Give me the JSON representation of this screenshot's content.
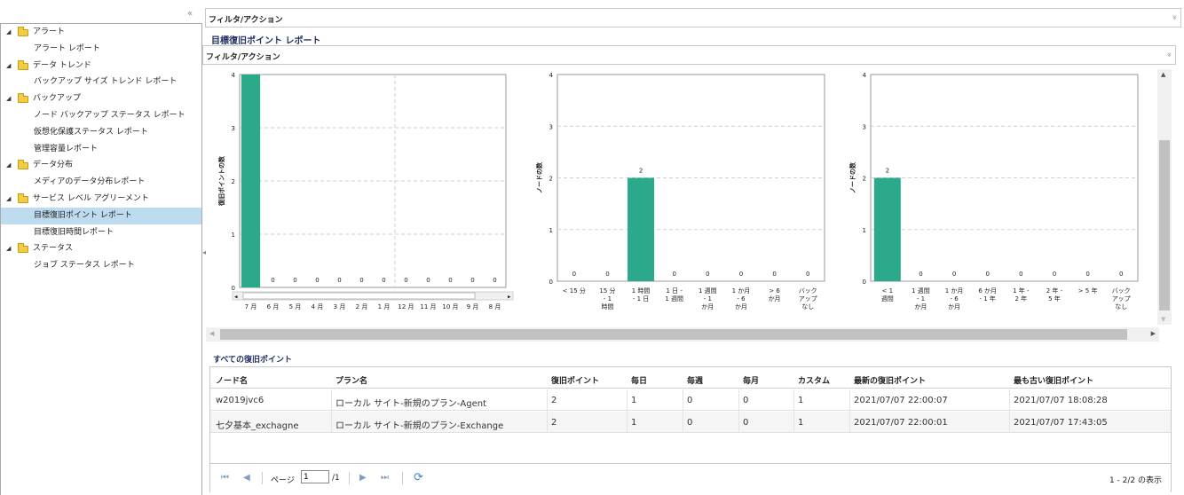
{
  "sidebar": {
    "collapse_glyph": "«",
    "groups": [
      {
        "label": "アラート",
        "items": [
          "アラート レポート"
        ]
      },
      {
        "label": "データ トレンド",
        "items": [
          "バックアップ サイズ トレンド レポート"
        ]
      },
      {
        "label": "バックアップ",
        "items": [
          "ノード バックアップ ステータス レポート",
          "仮想化保護ステータス レポート",
          "管理容量レポート"
        ]
      },
      {
        "label": "データ分布",
        "items": [
          "メディアのデータ分布レポート"
        ]
      },
      {
        "label": "サービス レベル アグリーメント",
        "items": [
          "目標復旧ポイント レポート",
          "目標復旧時間レポート"
        ]
      },
      {
        "label": "ステータス",
        "items": [
          "ジョブ ステータス レポート"
        ]
      }
    ],
    "selected": "目標復旧ポイント レポート"
  },
  "main": {
    "outer_panel_title": "フィルタ/アクション",
    "report_title": "目標復旧ポイント レポート",
    "inner_panel_title": "フィルタ/アクション",
    "grid_title": "すべての復旧ポイント"
  },
  "chart_data": [
    {
      "type": "bar",
      "ylabel": "復旧ポイントの数",
      "ylim": [
        0,
        4
      ],
      "yticks": [
        0,
        1,
        2,
        3,
        4
      ],
      "categories": [
        "7 月",
        "6 月",
        "5 月",
        "4 月",
        "3 月",
        "2 月",
        "1 月",
        "12 月",
        "11 月",
        "10 月",
        "9 月",
        "8 月"
      ],
      "values": [
        4,
        0,
        0,
        0,
        0,
        0,
        0,
        0,
        0,
        0,
        0,
        0
      ],
      "bar_color": "#2aaa8a",
      "grid": true,
      "has_scrollbar": true
    },
    {
      "type": "bar",
      "ylabel": "ノードの数",
      "ylim": [
        0,
        4
      ],
      "yticks": [
        0,
        1,
        2,
        3,
        4
      ],
      "categories": [
        "< 15 分",
        "15 分 - 1 時間",
        "1 時間 - 1 日",
        "1 日 - 1 週間",
        "1 週間 - 1 か月",
        "1 か月 - 6 か月",
        "> 6 か月",
        "バック アップ なし"
      ],
      "category_lines": [
        [
          "< 15 分"
        ],
        [
          "15 分",
          "- 1",
          "時間"
        ],
        [
          "1 時間",
          "- 1 日"
        ],
        [
          "1 日 -",
          "1 週間"
        ],
        [
          "1 週間",
          "- 1",
          "か月"
        ],
        [
          "1 か月",
          "- 6",
          "か月"
        ],
        [
          "> 6",
          "か月"
        ],
        [
          "バック",
          "アップ",
          "なし"
        ]
      ],
      "values": [
        0,
        0,
        2,
        0,
        0,
        0,
        0,
        0
      ],
      "bar_color": "#2aaa8a",
      "grid": true
    },
    {
      "type": "bar",
      "ylabel": "ノードの数",
      "ylim": [
        0,
        4
      ],
      "yticks": [
        0,
        1,
        2,
        3,
        4
      ],
      "categories": [
        "< 1 週間",
        "1 週間 - 1 か月",
        "1 か月 - 6 か月",
        "6 か月 - 1 年",
        "1 年 - 2 年",
        "2 年 - 5 年",
        "> 5 年",
        "バック アップ なし"
      ],
      "category_lines": [
        [
          "< 1",
          "週間"
        ],
        [
          "1 週間",
          "- 1",
          "か月"
        ],
        [
          "1 か月",
          "- 6",
          "か月"
        ],
        [
          "6 か月",
          "- 1 年"
        ],
        [
          "1 年 -",
          "2 年"
        ],
        [
          "2 年 -",
          "5 年"
        ],
        [
          "> 5 年"
        ],
        [
          "バック",
          "アップ",
          "なし"
        ]
      ],
      "values": [
        2,
        0,
        0,
        0,
        0,
        0,
        0,
        0
      ],
      "bar_color": "#2aaa8a",
      "grid": true
    }
  ],
  "grid": {
    "columns": [
      "ノード名",
      "プラン名",
      "復旧ポイント",
      "毎日",
      "毎週",
      "毎月",
      "カスタム",
      "最新の復旧ポイント",
      "最も古い復旧ポイント"
    ],
    "rows": [
      [
        "w2019jvc6",
        "ローカル サイト-新規のプラン-Agent",
        "2",
        "1",
        "0",
        "0",
        "1",
        "2021/07/07 22:00:07",
        "2021/07/07 18:08:28"
      ],
      [
        "七夕基本_exchagne",
        "ローカル サイト-新規のプラン-Exchange",
        "2",
        "1",
        "0",
        "0",
        "1",
        "2021/07/07 22:00:01",
        "2021/07/07 17:43:05"
      ]
    ]
  },
  "pager": {
    "page_label": "ページ",
    "page_value": "1",
    "page_total": "/1",
    "info": "1 - 2/2 の表示"
  }
}
